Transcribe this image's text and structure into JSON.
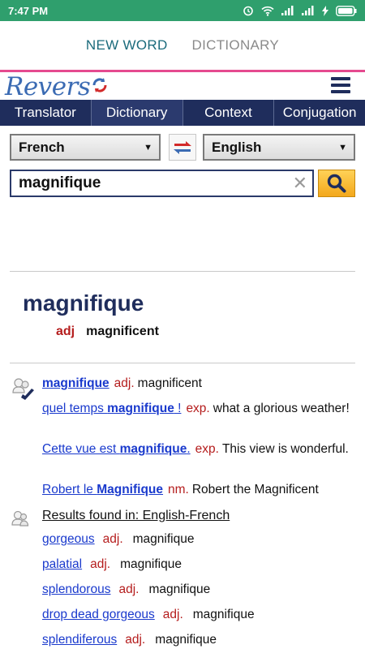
{
  "status_bar": {
    "time": "7:47 PM",
    "accent": "#2f9f6d"
  },
  "app_tabs": [
    {
      "label": "NEW WORD",
      "active": true
    },
    {
      "label": "DICTIONARY",
      "active": false
    }
  ],
  "logo": {
    "text": "Revers",
    "icon": "reverso-logo-o-icon"
  },
  "nav": [
    {
      "label": "Translator"
    },
    {
      "label": "Dictionary",
      "active": true
    },
    {
      "label": "Context"
    },
    {
      "label": "Conjugation"
    }
  ],
  "languages": {
    "source": "French",
    "target": "English"
  },
  "search": {
    "value": "magnifique"
  },
  "headword": {
    "word": "magnifique",
    "pos": "adj",
    "translation": "magnificent"
  },
  "entries": [
    {
      "term": "magnifique",
      "pos": "adj.",
      "translation": "magnificent"
    },
    {
      "term_pre": "quel temps ",
      "term_kw": "magnifique",
      "term_post": " !",
      "pos": "exp.",
      "translation": "what a glorious weather!"
    },
    {
      "term_pre": "Cette vue est ",
      "term_kw": "magnifique",
      "term_post": ".",
      "pos": "exp.",
      "translation": "This view is wonderful."
    },
    {
      "term_pre": "Robert le ",
      "term_kw": "Magnifique",
      "term_post": "",
      "pos": "nm.",
      "translation": "Robert the Magnificent"
    }
  ],
  "results": {
    "heading": "Results found in: English-French",
    "items": [
      {
        "term": "gorgeous",
        "pos": "adj.",
        "translation": "magnifique"
      },
      {
        "term": "palatial",
        "pos": "adj.",
        "translation": "magnifique"
      },
      {
        "term": "splendorous",
        "pos": "adj.",
        "translation": "magnifique"
      },
      {
        "term": "drop dead gorgeous",
        "pos": "adj.",
        "translation": "magnifique"
      },
      {
        "term": "splendiferous",
        "pos": "adj.",
        "translation": "magnifique"
      }
    ]
  },
  "colors": {
    "nav_bg": "#1f2d5c",
    "pos_red": "#b51d1d",
    "link_blue": "#1a3acd",
    "accent_pink": "#e54b8f",
    "search_button": "#f3a81c"
  }
}
